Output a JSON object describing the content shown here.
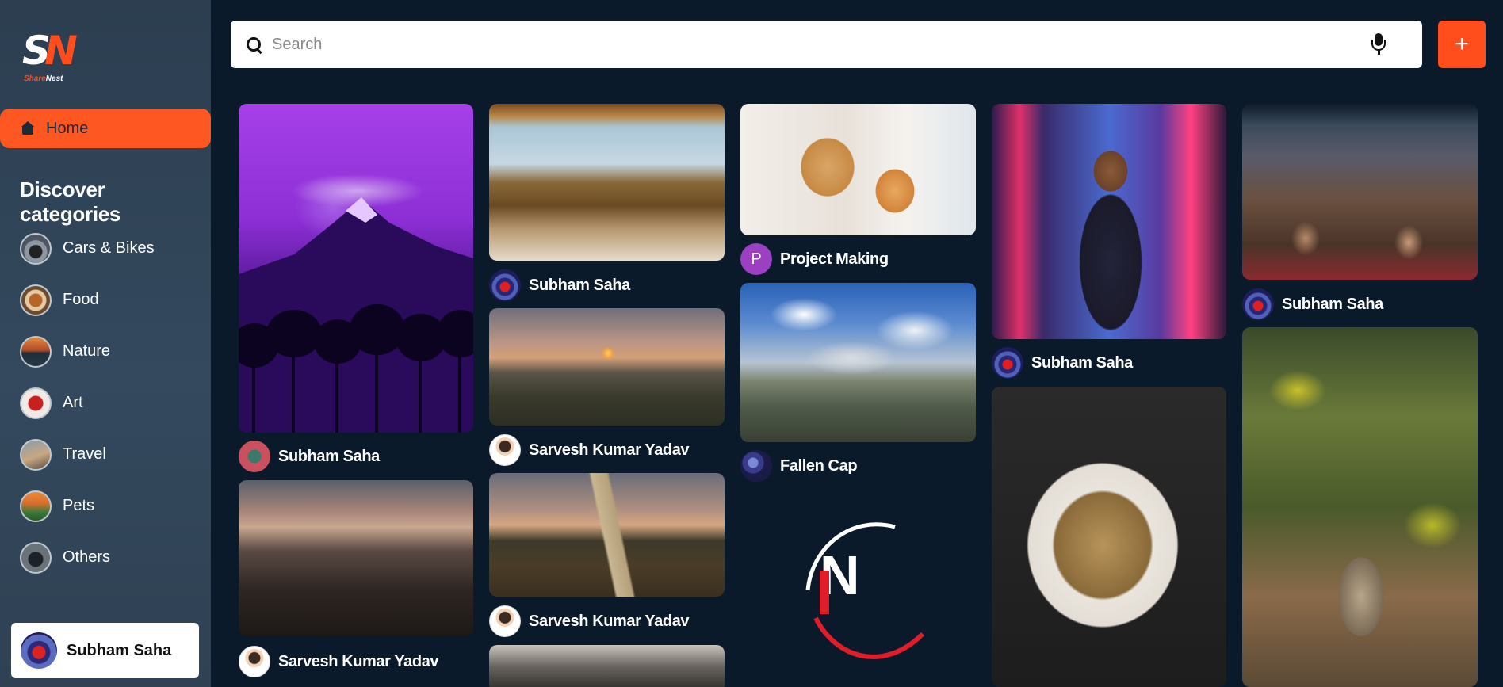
{
  "app": {
    "logo_text_a": "Share",
    "logo_text_b": "Nest"
  },
  "sidebar": {
    "home_label": "Home",
    "discover_title": "Discover categories",
    "categories": [
      {
        "label": "Cars & Bikes"
      },
      {
        "label": "Food"
      },
      {
        "label": "Nature"
      },
      {
        "label": "Art"
      },
      {
        "label": "Travel"
      },
      {
        "label": "Pets"
      },
      {
        "label": "Others"
      }
    ],
    "user_name": "Subham Saha"
  },
  "search": {
    "placeholder": "Search"
  },
  "toolbar": {
    "add_label": "+"
  },
  "pins": {
    "col1": [
      {
        "author": "Subham Saha"
      },
      {
        "author": "Sarvesh Kumar Yadav"
      }
    ],
    "col2": [
      {
        "author": "Subham Saha"
      },
      {
        "author": "Sarvesh Kumar Yadav"
      },
      {
        "author": "Sarvesh Kumar Yadav"
      }
    ],
    "col3": [
      {
        "author": "Project Making",
        "avatar_letter": "P"
      },
      {
        "author": "Fallen Cap"
      }
    ],
    "col4": [
      {
        "author": "Subham Saha"
      }
    ],
    "col5": [
      {
        "author": "Subham Saha"
      }
    ]
  },
  "colors": {
    "accent": "#ff5722",
    "background": "#0b1a2a",
    "sidebar": "#2c3e50"
  }
}
